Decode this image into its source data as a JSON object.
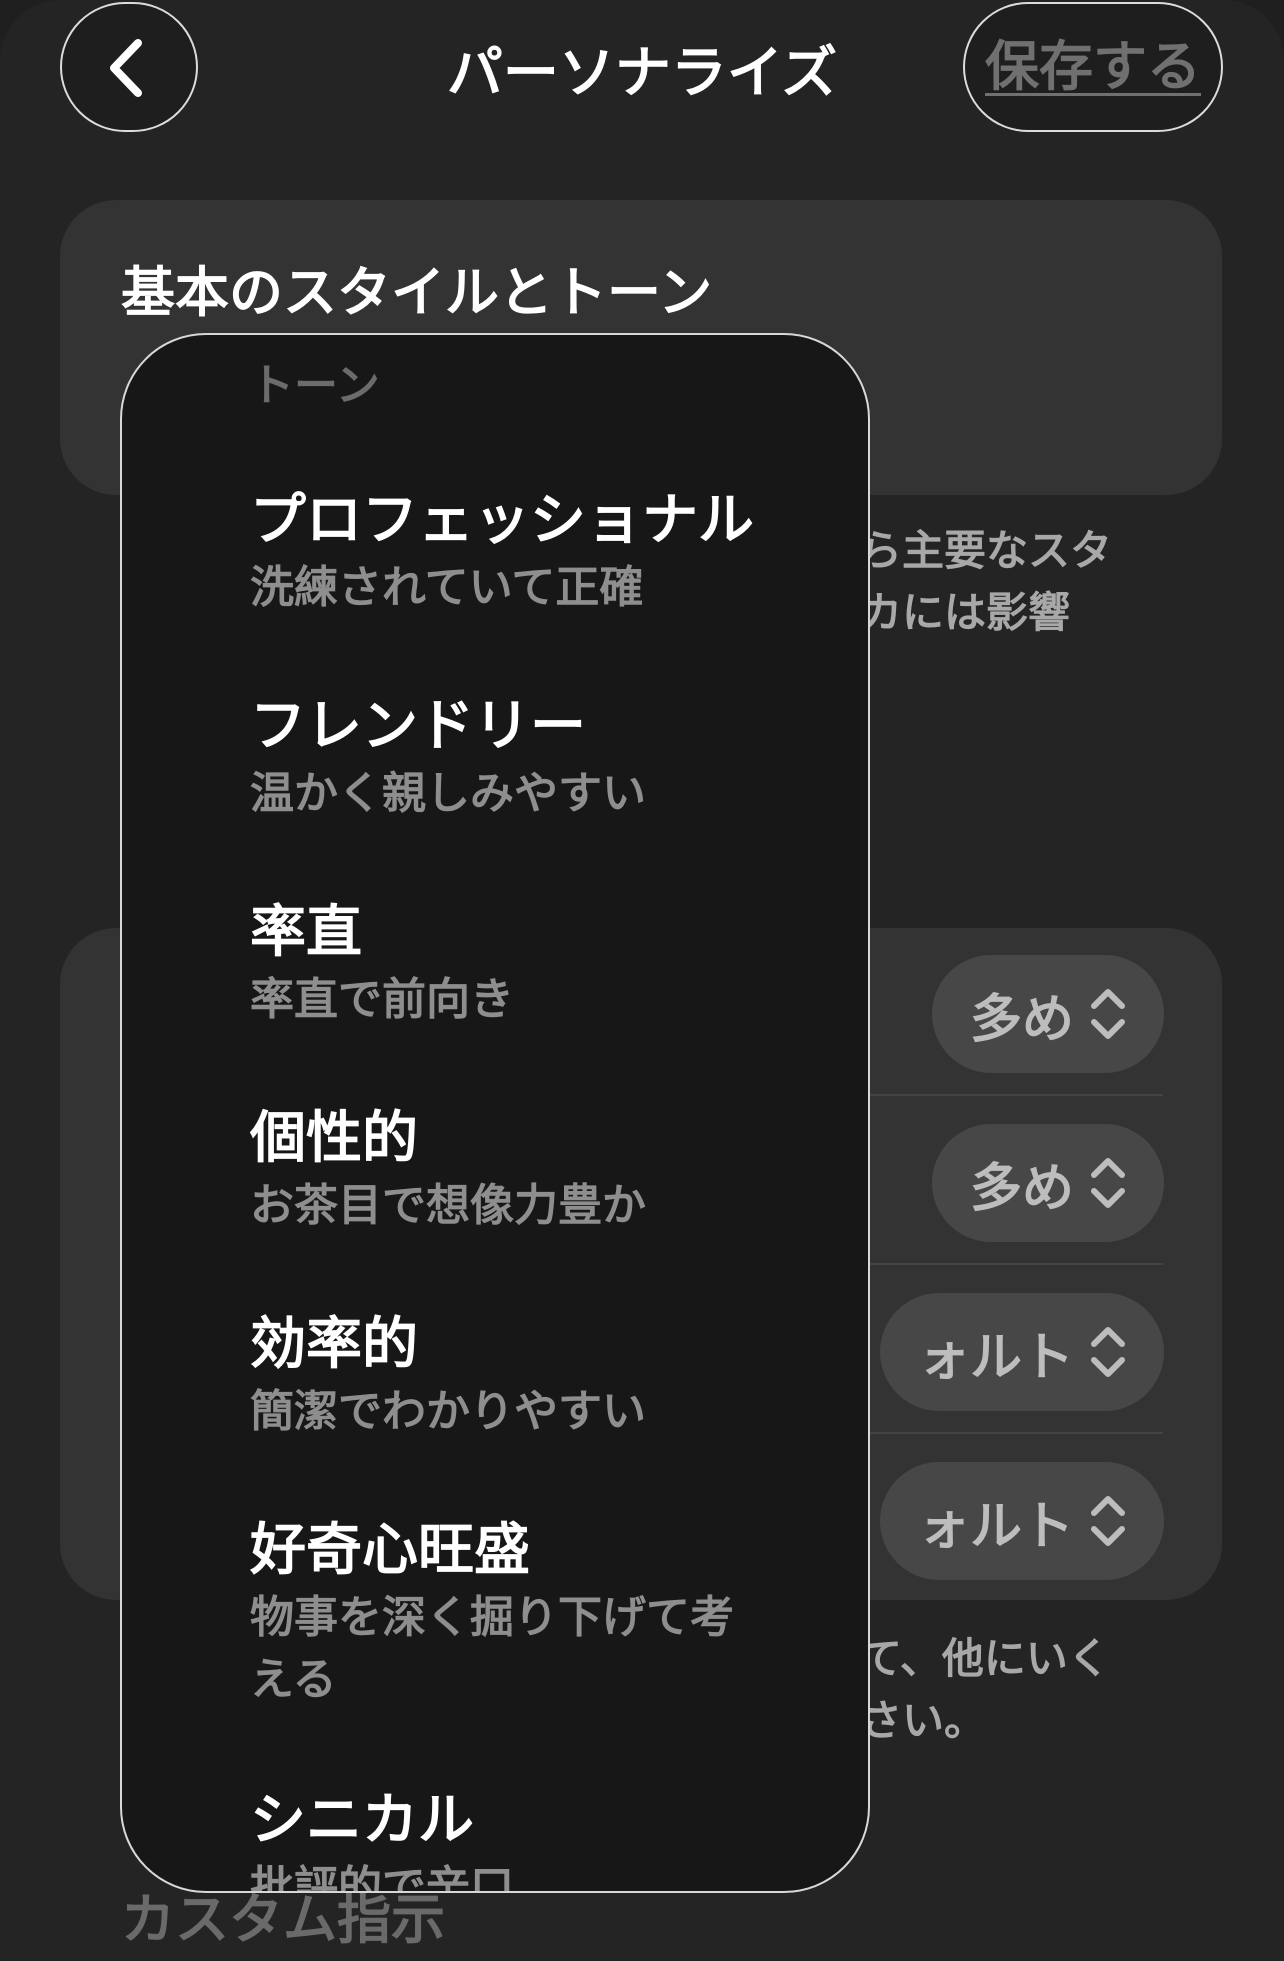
{
  "header": {
    "title": "パーソナライズ",
    "save_label": "保存する"
  },
  "style_section": {
    "heading": "基本のスタイルとトーン",
    "description_fragment": "ら主要なスタ\nカには影響"
  },
  "characteristics": {
    "rows": [
      {
        "value": "多め"
      },
      {
        "value": "多め"
      },
      {
        "value": "ォルト"
      },
      {
        "value": "ォルト"
      }
    ],
    "note_fragment": "て、他にいく\nさい。"
  },
  "custom_instructions": {
    "heading": "カスタム指示"
  },
  "tone_menu": {
    "header": "トーン",
    "options": [
      {
        "label": "プロフェッショナル",
        "description": "洗練されていて正確"
      },
      {
        "label": "フレンドリー",
        "description": "温かく親しみやすい"
      },
      {
        "label": "率直",
        "description": "率直で前向き"
      },
      {
        "label": "個性的",
        "description": "お茶目で想像力豊か"
      },
      {
        "label": "効率的",
        "description": "簡潔でわかりやすい"
      },
      {
        "label": "好奇心旺盛",
        "description": "物事を深く掘り下げて考える"
      },
      {
        "label": "シニカル",
        "description": "批評的で辛口"
      }
    ]
  }
}
